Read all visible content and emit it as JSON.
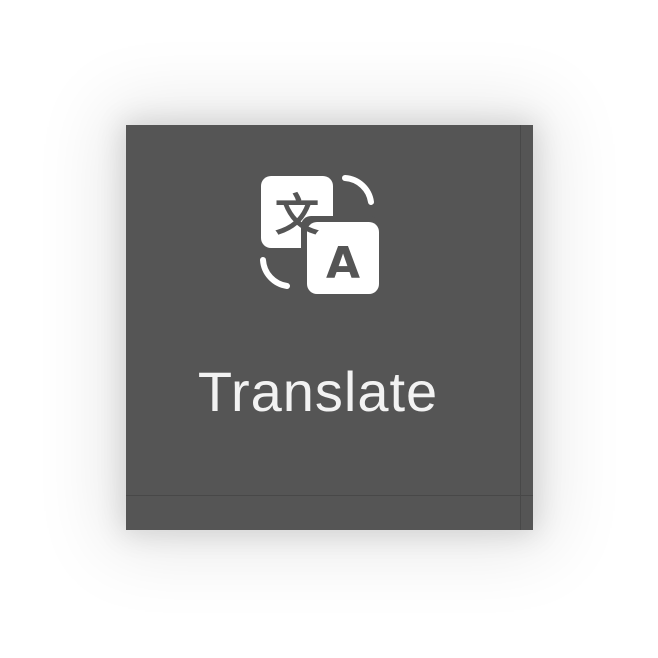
{
  "tile": {
    "label": "Translate",
    "icon": "translate-icon",
    "icon_glyph_source": "文",
    "icon_glyph_target": "A"
  },
  "colors": {
    "tile_background": "#555555",
    "icon_color": "#ffffff",
    "label_color": "#f2f2f2"
  }
}
